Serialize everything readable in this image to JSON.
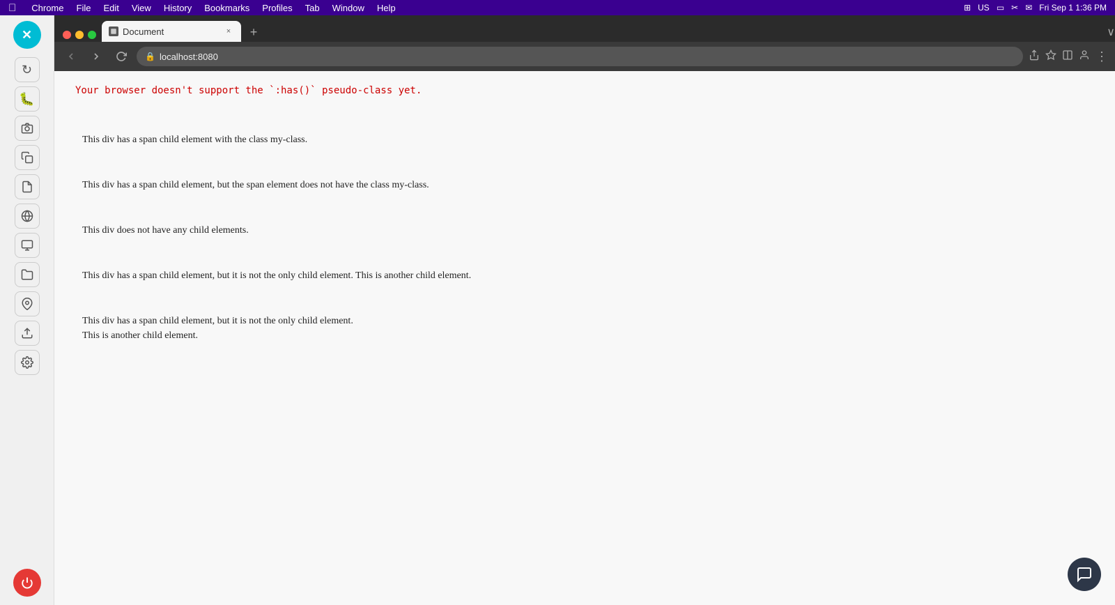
{
  "menubar": {
    "apple": "&#63743;",
    "items": [
      "Chrome",
      "File",
      "Edit",
      "View",
      "History",
      "Bookmarks",
      "Profiles",
      "Tab",
      "Window",
      "Help"
    ],
    "clock": "Fri Sep 1  1:36 PM"
  },
  "sidebar": {
    "topButton": "✕",
    "icons": [
      "↻",
      "🐞",
      "📷",
      "📋",
      "📄",
      "🌐",
      "🖥",
      "📁",
      "📍",
      "⬆",
      "⚙"
    ],
    "powerIcon": "⏻"
  },
  "browser": {
    "trafficLights": {
      "red": "",
      "yellow": "",
      "green": ""
    },
    "tab": {
      "favicon": "📄",
      "title": "Document",
      "closeLabel": "×"
    },
    "addTabLabel": "+",
    "windowCollapseLabel": "∨",
    "nav": {
      "backLabel": "‹",
      "forwardLabel": "›",
      "refreshLabel": "↻",
      "addressIcon": "🔒",
      "addressText": "localhost:8080",
      "shareIcon": "⬆",
      "bookmarkIcon": "☆",
      "splitIcon": "⧉",
      "profileIcon": "👤",
      "moreIcon": "⋮"
    },
    "content": {
      "warning": "Your browser doesn't support the `:has()` pseudo-class yet.",
      "blocks": [
        {
          "text": "This div has a span child element with the class my-class."
        },
        {
          "text": "This div has a span child element, but the span element does not have the class my-class."
        },
        {
          "text": "This div does not have any child elements."
        },
        {
          "text": "This div has a span child element, but it is not the only child element. This is another child element."
        },
        {
          "lines": [
            "This div has a span child element, but it is not the only child element.",
            "This is another child element."
          ]
        }
      ]
    }
  },
  "chatButton": "💬"
}
